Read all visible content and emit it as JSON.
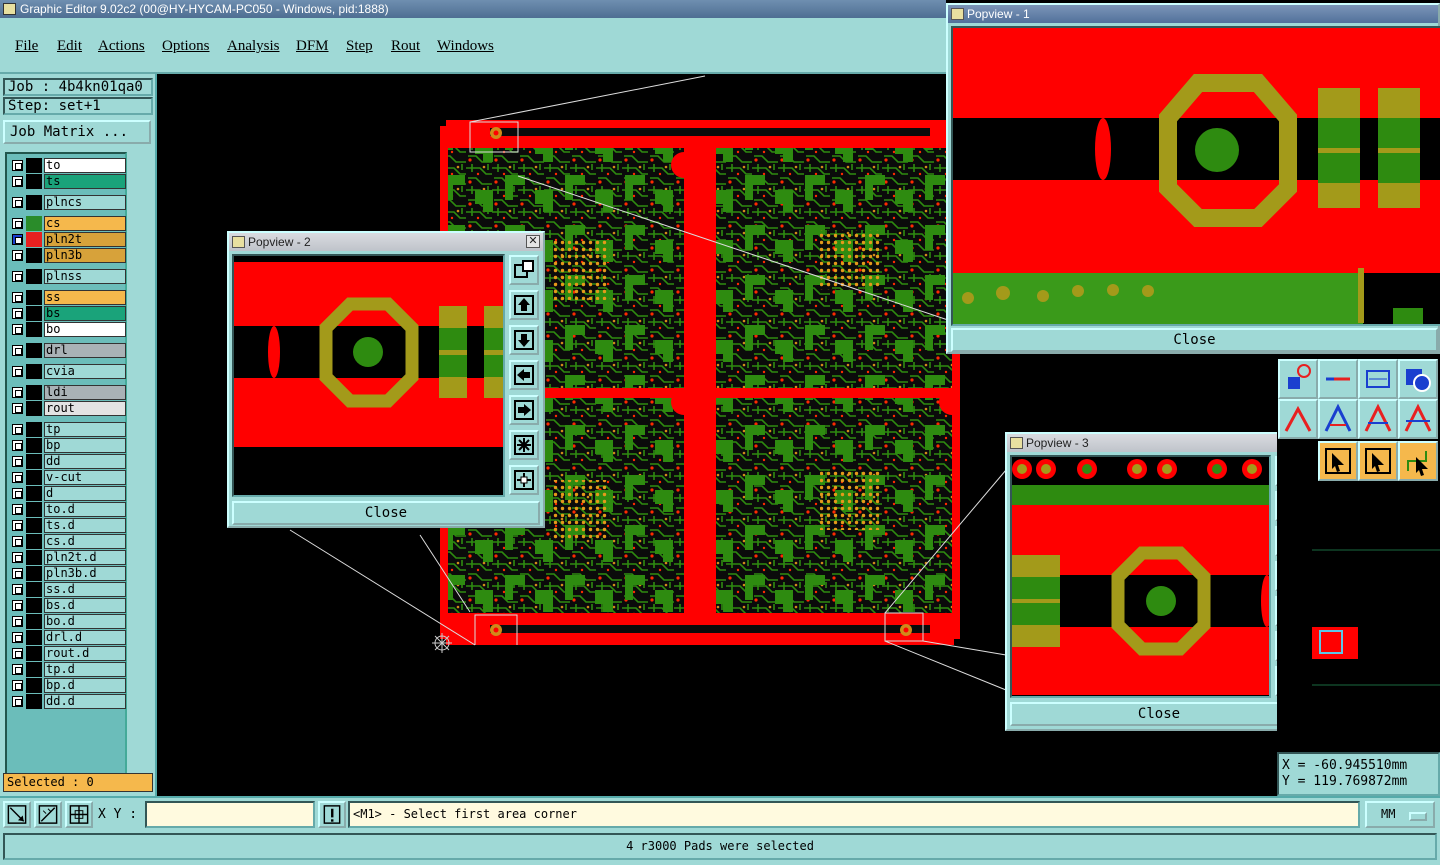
{
  "window": {
    "title": "Graphic Editor 9.02c2 (00@HY-HYCAM-PC050 - Windows, pid:1888)"
  },
  "menu": [
    "File",
    "Edit",
    "Actions",
    "Options",
    "Analysis",
    "DFM",
    "Step",
    "Rout",
    "Windows"
  ],
  "left_panel": {
    "job": "Job : 4b4kn01qa0",
    "step": "Step: set+1",
    "job_matrix": "Job Matrix ...",
    "selected": "Selected : 0"
  },
  "layers": [
    {
      "name": "to",
      "color": "#ffffff",
      "sw": "#000000"
    },
    {
      "name": "ts",
      "color": "#1aa37a",
      "sw": "#000000"
    },
    {
      "name": "plncs",
      "color": "#9fd9d6",
      "sw": "#000000"
    },
    {
      "name": "cs",
      "color": "#f5b84c",
      "sw": "#2a8c2a"
    },
    {
      "name": "pln2t",
      "color": "#d7a23a",
      "sw": "#e82020",
      "active": true
    },
    {
      "name": "pln3b",
      "color": "#d7a23a",
      "sw": "#000000"
    },
    {
      "name": "plnss",
      "color": "#9fd9d6",
      "sw": "#000000"
    },
    {
      "name": "ss",
      "color": "#f5b84c",
      "sw": "#000000"
    },
    {
      "name": "bs",
      "color": "#1aa37a",
      "sw": "#000000"
    },
    {
      "name": "bo",
      "color": "#ffffff",
      "sw": "#000000"
    },
    {
      "name": "drl",
      "color": "#a9b2b6",
      "sw": "#000000"
    },
    {
      "name": "cvia",
      "color": "#9fd9d6",
      "sw": "#000000"
    },
    {
      "name": "ldi",
      "color": "#a9b2b6",
      "sw": "#000000"
    },
    {
      "name": "rout",
      "color": "#e3e3e3",
      "sw": "#000000"
    },
    {
      "name": "tp",
      "color": "#9fd9d6",
      "sw": "#000000"
    },
    {
      "name": "bp",
      "color": "#9fd9d6",
      "sw": "#000000"
    },
    {
      "name": "dd",
      "color": "#9fd9d6",
      "sw": "#000000"
    },
    {
      "name": "v-cut",
      "color": "#9fd9d6",
      "sw": "#000000"
    },
    {
      "name": "d",
      "color": "#9fd9d6",
      "sw": "#000000"
    },
    {
      "name": "to.d",
      "color": "#9fd9d6",
      "sw": "#000000"
    },
    {
      "name": "ts.d",
      "color": "#9fd9d6",
      "sw": "#000000"
    },
    {
      "name": "cs.d",
      "color": "#9fd9d6",
      "sw": "#000000"
    },
    {
      "name": "pln2t.d",
      "color": "#9fd9d6",
      "sw": "#000000"
    },
    {
      "name": "pln3b.d",
      "color": "#9fd9d6",
      "sw": "#000000"
    },
    {
      "name": "ss.d",
      "color": "#9fd9d6",
      "sw": "#000000"
    },
    {
      "name": "bs.d",
      "color": "#9fd9d6",
      "sw": "#000000"
    },
    {
      "name": "bo.d",
      "color": "#9fd9d6",
      "sw": "#000000"
    },
    {
      "name": "drl.d",
      "color": "#9fd9d6",
      "sw": "#000000"
    },
    {
      "name": "rout.d",
      "color": "#9fd9d6",
      "sw": "#000000"
    },
    {
      "name": "tp.d",
      "color": "#9fd9d6",
      "sw": "#000000"
    },
    {
      "name": "bp.d",
      "color": "#9fd9d6",
      "sw": "#000000"
    },
    {
      "name": "dd.d",
      "color": "#9fd9d6",
      "sw": "#000000"
    }
  ],
  "popviews": {
    "p1": {
      "title": "Popview - 1",
      "close": "Close"
    },
    "p2": {
      "title": "Popview - 2",
      "close": "Close"
    },
    "p3": {
      "title": "Popview - 3",
      "close": "Close"
    }
  },
  "coords": {
    "x": "X = -60.945510mm",
    "y": "Y = 119.769872mm"
  },
  "bottom": {
    "xy_label": "X Y :",
    "xy_value": "",
    "prompt": "<M1> - Select first area corner",
    "units": "MM",
    "status": "4 r3000 Pads were selected"
  },
  "colors": {
    "copper": "#ff0000",
    "green": "#2e8b10",
    "olive": "#a39a1a",
    "panel": "#9fd9d6"
  }
}
